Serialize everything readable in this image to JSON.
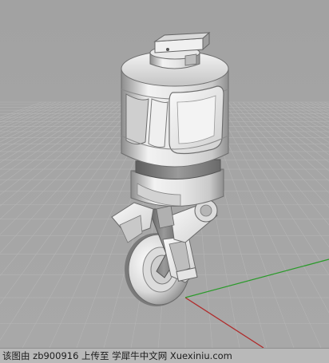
{
  "viewport": {
    "grid_color": "#b5b5b5",
    "background_color": "#a4a4a4",
    "x_axis_color": "#b02a2a",
    "y_axis_color": "#2a9a2a",
    "model_color": "#e9e9e9"
  },
  "watermark": {
    "text": "该图由 zb900916 上传至 学犀牛中文网 Xuexiniu.com"
  }
}
